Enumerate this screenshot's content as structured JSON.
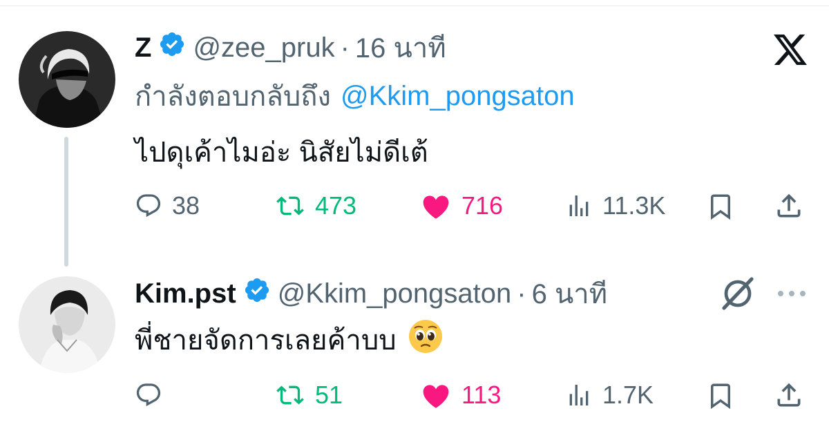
{
  "colors": {
    "verified": "#1d9bf0",
    "mention": "#1d9bf0",
    "secondary_text": "#536471",
    "retweet": "#00ba7c",
    "like": "#f91880",
    "thread_line": "#cfd9de"
  },
  "logo": {
    "icon": "x-logo-icon"
  },
  "tweet1": {
    "name": "Z",
    "verified_icon": "verified-badge-icon",
    "handle": "@zee_pruk",
    "separator": "·",
    "time": "16 นาที",
    "reply_prefix": "กำลังตอบกลับถึง",
    "reply_mention": "@Kkim_pongsaton",
    "text": "ไปดุเค้าไมอ่ะ นิสัยไม่ดีเต้",
    "actions": {
      "replies": "38",
      "retweets": "473",
      "likes": "716",
      "views": "11.3K"
    }
  },
  "tweet2": {
    "name": "Kim.pst",
    "verified_icon": "verified-badge-icon",
    "handle": "@Kkim_pongsaton",
    "separator": "·",
    "time": "6 นาที",
    "text": "พี่ชายจัดการเลยค้าบบ",
    "emoji": "pleading-face-emoji",
    "actions": {
      "replies": "",
      "retweets": "51",
      "likes": "113",
      "views": "1.7K"
    }
  }
}
